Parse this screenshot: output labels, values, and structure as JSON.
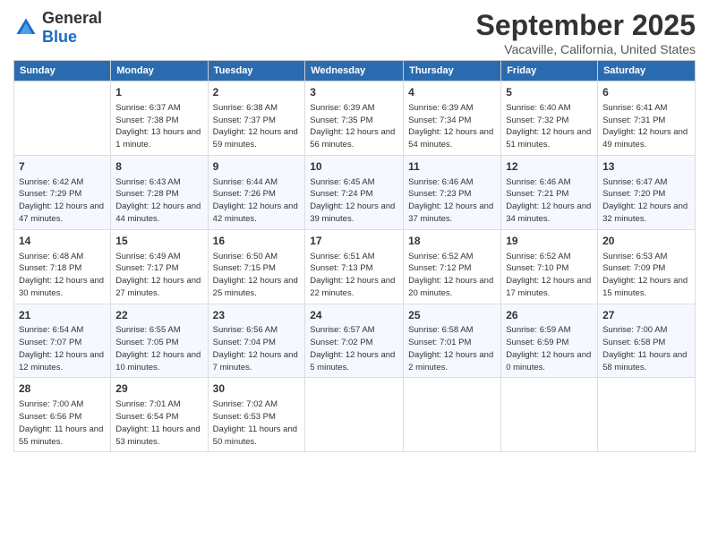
{
  "logo": {
    "general": "General",
    "blue": "Blue"
  },
  "title": "September 2025",
  "location": "Vacaville, California, United States",
  "headers": [
    "Sunday",
    "Monday",
    "Tuesday",
    "Wednesday",
    "Thursday",
    "Friday",
    "Saturday"
  ],
  "weeks": [
    [
      {
        "day": "",
        "sunrise": "",
        "sunset": "",
        "daylight": ""
      },
      {
        "day": "1",
        "sunrise": "Sunrise: 6:37 AM",
        "sunset": "Sunset: 7:38 PM",
        "daylight": "Daylight: 13 hours and 1 minute."
      },
      {
        "day": "2",
        "sunrise": "Sunrise: 6:38 AM",
        "sunset": "Sunset: 7:37 PM",
        "daylight": "Daylight: 12 hours and 59 minutes."
      },
      {
        "day": "3",
        "sunrise": "Sunrise: 6:39 AM",
        "sunset": "Sunset: 7:35 PM",
        "daylight": "Daylight: 12 hours and 56 minutes."
      },
      {
        "day": "4",
        "sunrise": "Sunrise: 6:39 AM",
        "sunset": "Sunset: 7:34 PM",
        "daylight": "Daylight: 12 hours and 54 minutes."
      },
      {
        "day": "5",
        "sunrise": "Sunrise: 6:40 AM",
        "sunset": "Sunset: 7:32 PM",
        "daylight": "Daylight: 12 hours and 51 minutes."
      },
      {
        "day": "6",
        "sunrise": "Sunrise: 6:41 AM",
        "sunset": "Sunset: 7:31 PM",
        "daylight": "Daylight: 12 hours and 49 minutes."
      }
    ],
    [
      {
        "day": "7",
        "sunrise": "Sunrise: 6:42 AM",
        "sunset": "Sunset: 7:29 PM",
        "daylight": "Daylight: 12 hours and 47 minutes."
      },
      {
        "day": "8",
        "sunrise": "Sunrise: 6:43 AM",
        "sunset": "Sunset: 7:28 PM",
        "daylight": "Daylight: 12 hours and 44 minutes."
      },
      {
        "day": "9",
        "sunrise": "Sunrise: 6:44 AM",
        "sunset": "Sunset: 7:26 PM",
        "daylight": "Daylight: 12 hours and 42 minutes."
      },
      {
        "day": "10",
        "sunrise": "Sunrise: 6:45 AM",
        "sunset": "Sunset: 7:24 PM",
        "daylight": "Daylight: 12 hours and 39 minutes."
      },
      {
        "day": "11",
        "sunrise": "Sunrise: 6:46 AM",
        "sunset": "Sunset: 7:23 PM",
        "daylight": "Daylight: 12 hours and 37 minutes."
      },
      {
        "day": "12",
        "sunrise": "Sunrise: 6:46 AM",
        "sunset": "Sunset: 7:21 PM",
        "daylight": "Daylight: 12 hours and 34 minutes."
      },
      {
        "day": "13",
        "sunrise": "Sunrise: 6:47 AM",
        "sunset": "Sunset: 7:20 PM",
        "daylight": "Daylight: 12 hours and 32 minutes."
      }
    ],
    [
      {
        "day": "14",
        "sunrise": "Sunrise: 6:48 AM",
        "sunset": "Sunset: 7:18 PM",
        "daylight": "Daylight: 12 hours and 30 minutes."
      },
      {
        "day": "15",
        "sunrise": "Sunrise: 6:49 AM",
        "sunset": "Sunset: 7:17 PM",
        "daylight": "Daylight: 12 hours and 27 minutes."
      },
      {
        "day": "16",
        "sunrise": "Sunrise: 6:50 AM",
        "sunset": "Sunset: 7:15 PM",
        "daylight": "Daylight: 12 hours and 25 minutes."
      },
      {
        "day": "17",
        "sunrise": "Sunrise: 6:51 AM",
        "sunset": "Sunset: 7:13 PM",
        "daylight": "Daylight: 12 hours and 22 minutes."
      },
      {
        "day": "18",
        "sunrise": "Sunrise: 6:52 AM",
        "sunset": "Sunset: 7:12 PM",
        "daylight": "Daylight: 12 hours and 20 minutes."
      },
      {
        "day": "19",
        "sunrise": "Sunrise: 6:52 AM",
        "sunset": "Sunset: 7:10 PM",
        "daylight": "Daylight: 12 hours and 17 minutes."
      },
      {
        "day": "20",
        "sunrise": "Sunrise: 6:53 AM",
        "sunset": "Sunset: 7:09 PM",
        "daylight": "Daylight: 12 hours and 15 minutes."
      }
    ],
    [
      {
        "day": "21",
        "sunrise": "Sunrise: 6:54 AM",
        "sunset": "Sunset: 7:07 PM",
        "daylight": "Daylight: 12 hours and 12 minutes."
      },
      {
        "day": "22",
        "sunrise": "Sunrise: 6:55 AM",
        "sunset": "Sunset: 7:05 PM",
        "daylight": "Daylight: 12 hours and 10 minutes."
      },
      {
        "day": "23",
        "sunrise": "Sunrise: 6:56 AM",
        "sunset": "Sunset: 7:04 PM",
        "daylight": "Daylight: 12 hours and 7 minutes."
      },
      {
        "day": "24",
        "sunrise": "Sunrise: 6:57 AM",
        "sunset": "Sunset: 7:02 PM",
        "daylight": "Daylight: 12 hours and 5 minutes."
      },
      {
        "day": "25",
        "sunrise": "Sunrise: 6:58 AM",
        "sunset": "Sunset: 7:01 PM",
        "daylight": "Daylight: 12 hours and 2 minutes."
      },
      {
        "day": "26",
        "sunrise": "Sunrise: 6:59 AM",
        "sunset": "Sunset: 6:59 PM",
        "daylight": "Daylight: 12 hours and 0 minutes."
      },
      {
        "day": "27",
        "sunrise": "Sunrise: 7:00 AM",
        "sunset": "Sunset: 6:58 PM",
        "daylight": "Daylight: 11 hours and 58 minutes."
      }
    ],
    [
      {
        "day": "28",
        "sunrise": "Sunrise: 7:00 AM",
        "sunset": "Sunset: 6:56 PM",
        "daylight": "Daylight: 11 hours and 55 minutes."
      },
      {
        "day": "29",
        "sunrise": "Sunrise: 7:01 AM",
        "sunset": "Sunset: 6:54 PM",
        "daylight": "Daylight: 11 hours and 53 minutes."
      },
      {
        "day": "30",
        "sunrise": "Sunrise: 7:02 AM",
        "sunset": "Sunset: 6:53 PM",
        "daylight": "Daylight: 11 hours and 50 minutes."
      },
      {
        "day": "",
        "sunrise": "",
        "sunset": "",
        "daylight": ""
      },
      {
        "day": "",
        "sunrise": "",
        "sunset": "",
        "daylight": ""
      },
      {
        "day": "",
        "sunrise": "",
        "sunset": "",
        "daylight": ""
      },
      {
        "day": "",
        "sunrise": "",
        "sunset": "",
        "daylight": ""
      }
    ]
  ]
}
